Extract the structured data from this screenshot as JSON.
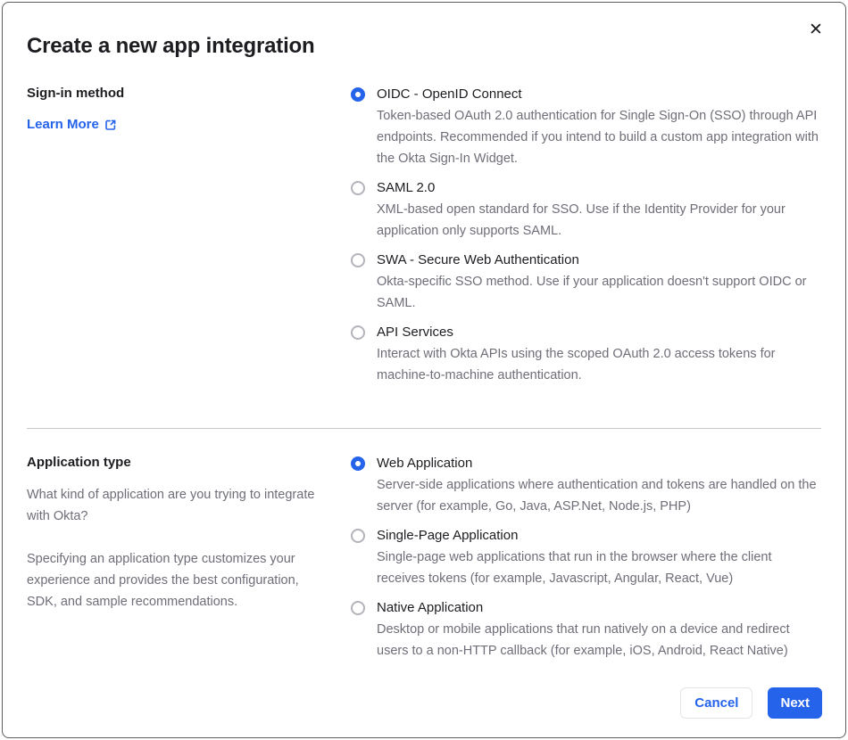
{
  "modal": {
    "title": "Create a new app integration",
    "close_glyph": "✕"
  },
  "signin": {
    "label": "Sign-in method",
    "learn_more_label": "Learn More",
    "options": [
      {
        "label": "OIDC - OpenID Connect",
        "description": "Token-based OAuth 2.0 authentication for Single Sign-On (SSO) through API endpoints. Recommended if you intend to build a custom app integration with the Okta Sign-In Widget.",
        "selected": true
      },
      {
        "label": "SAML 2.0",
        "description": "XML-based open standard for SSO. Use if the Identity Provider for your application only supports SAML.",
        "selected": false
      },
      {
        "label": "SWA - Secure Web Authentication",
        "description": "Okta-specific SSO method. Use if your application doesn't support OIDC or SAML.",
        "selected": false
      },
      {
        "label": "API Services",
        "description": "Interact with Okta APIs using the scoped OAuth 2.0 access tokens for machine-to-machine authentication.",
        "selected": false
      }
    ]
  },
  "apptype": {
    "label": "Application type",
    "question": "What kind of application are you trying to integrate with Okta?",
    "hint": "Specifying an application type customizes your experience and provides the best configuration, SDK, and sample recommendations.",
    "options": [
      {
        "label": "Web Application",
        "description": "Server-side applications where authentication and tokens are handled on the server (for example, Go, Java, ASP.Net, Node.js, PHP)",
        "selected": true
      },
      {
        "label": "Single-Page Application",
        "description": "Single-page web applications that run in the browser where the client receives tokens (for example, Javascript, Angular, React, Vue)",
        "selected": false
      },
      {
        "label": "Native Application",
        "description": "Desktop or mobile applications that run natively on a device and redirect users to a non-HTTP callback (for example, iOS, Android, React Native)",
        "selected": false
      }
    ]
  },
  "footer": {
    "cancel_label": "Cancel",
    "next_label": "Next"
  },
  "colors": {
    "accent_blue": "#2563eb",
    "text_dark": "#1d1d21",
    "text_gray": "#6e6e78",
    "divider_gray": "#c8c8cc"
  }
}
